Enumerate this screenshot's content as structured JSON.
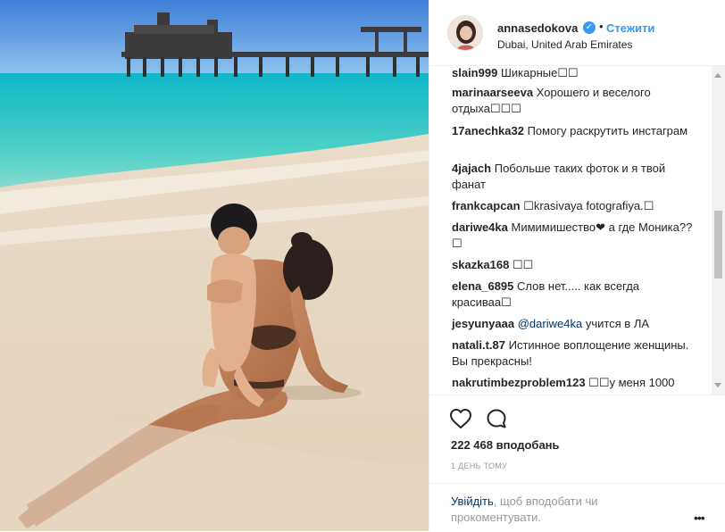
{
  "header": {
    "username": "annasedokova",
    "verified_icon": "verified-badge-icon",
    "separator": "•",
    "follow_label": "Стежити",
    "location": "Dubai, United Arab Emirates"
  },
  "comments": [
    {
      "user": "slain999",
      "text": "Шикарные☐☐"
    },
    {
      "user": "marinaarseeva",
      "text": "Хорошего и веселого отдыха☐☐☐"
    },
    {
      "user": "17anechka32",
      "text": "Помогу раскрутить инстаграм"
    },
    {
      "user": "4jajach",
      "text": "Побольше таких фоток и я твой фанат"
    },
    {
      "user": "frankcapcan",
      "text": "☐krasivaya fotografiya.☐"
    },
    {
      "user": "dariwe4ka",
      "text": "Мимимишество❤ а где Моника??☐"
    },
    {
      "user": "skazka168",
      "text": "☐☐"
    },
    {
      "user": "elena_6895",
      "text": "Слов нет..... как всегда красиваа☐"
    },
    {
      "user": "jesyunyaaa",
      "mention": "@dariwe4ka",
      "text": "учится в ЛА"
    },
    {
      "user": "natali.t.87",
      "text": "Истинное воплощение женщины. Вы прекрасны!"
    },
    {
      "user": "nakrutimbezproblem123",
      "text": "☐☐у меня 1000"
    }
  ],
  "actions": {
    "like_icon": "heart-icon",
    "comment_icon": "comment-bubble-icon",
    "likes": "222 468 вподобань",
    "time": "1 ДЕНЬ ТОМУ"
  },
  "login": {
    "link": "Увійдіть",
    "text": ", щоб вподобати чи прокоментувати."
  },
  "more_icon": "•••",
  "colors": {
    "accent": "#3897f0",
    "link": "#003569",
    "text": "#262626",
    "muted": "#999999",
    "border": "#efefef"
  }
}
